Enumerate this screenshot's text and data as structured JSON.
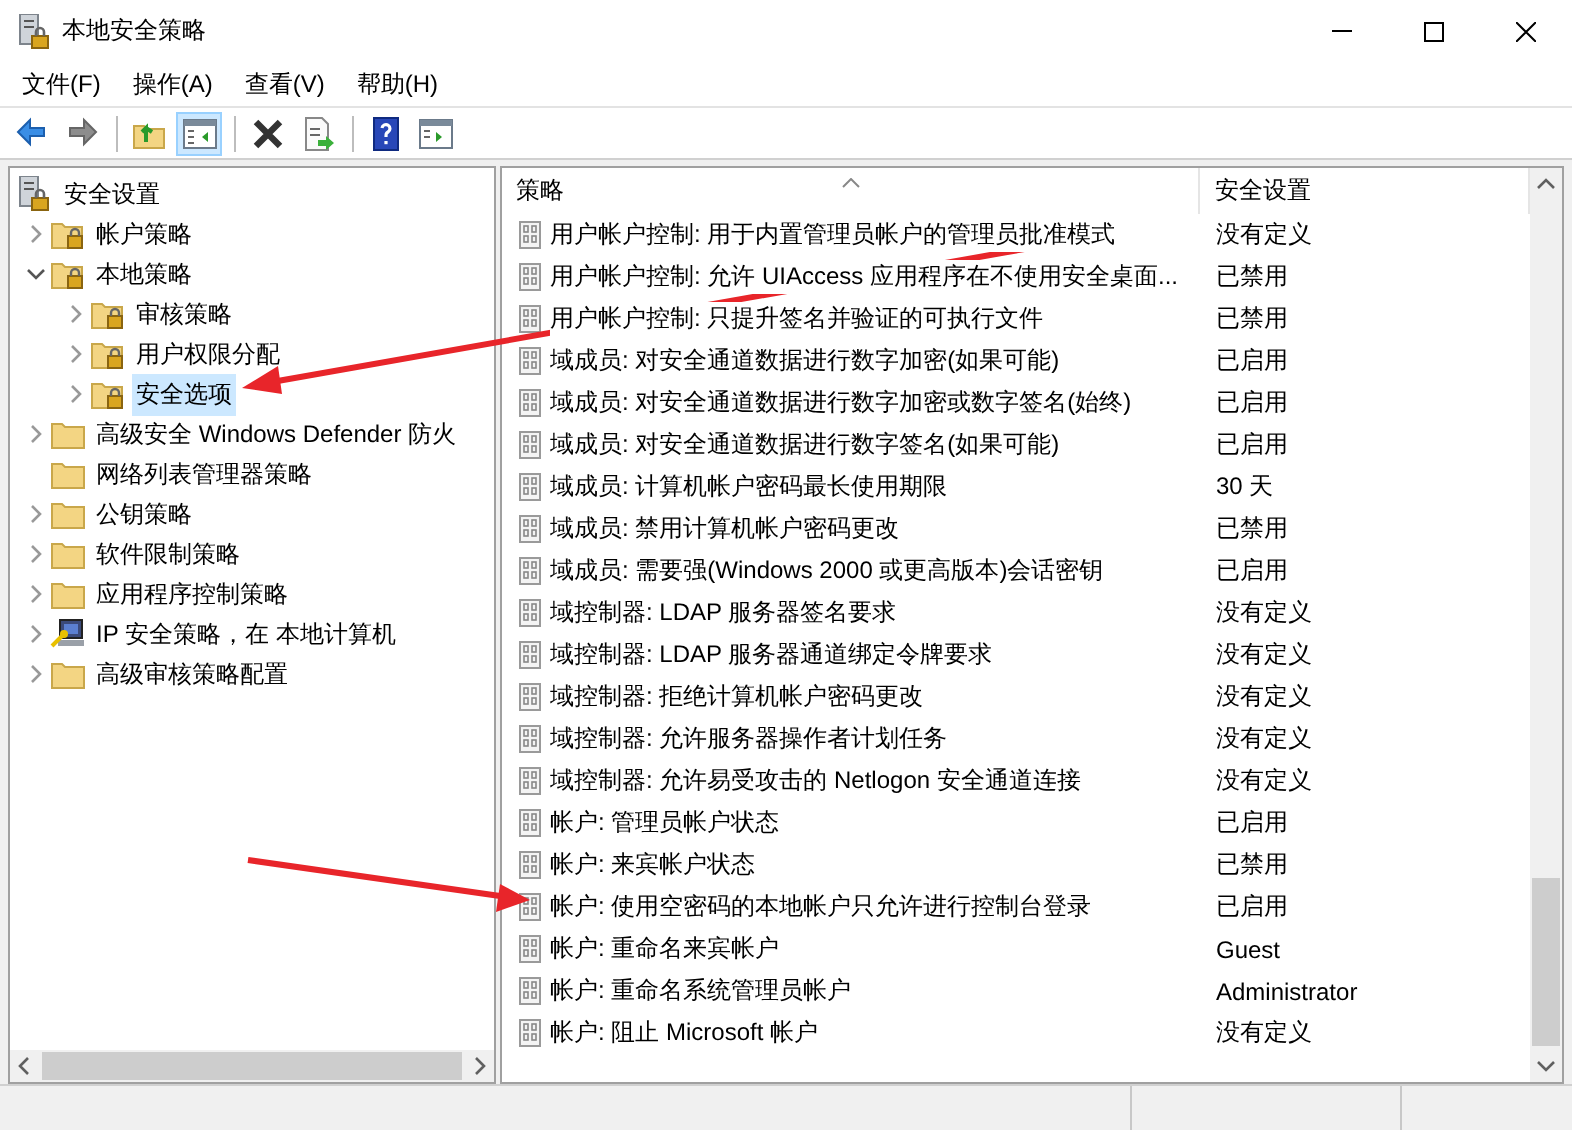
{
  "window": {
    "title": "本地安全策略"
  },
  "menu": [
    "文件(F)",
    "操作(A)",
    "查看(V)",
    "帮助(H)"
  ],
  "toolbar": [
    [
      {
        "kind": "back",
        "pressed": false
      },
      {
        "kind": "forward",
        "pressed": false
      }
    ],
    [
      {
        "kind": "up",
        "pressed": false
      },
      {
        "kind": "tree",
        "pressed": true
      }
    ],
    [
      {
        "kind": "delete",
        "pressed": false
      },
      {
        "kind": "export",
        "pressed": false
      }
    ],
    [
      {
        "kind": "help",
        "pressed": false
      },
      {
        "kind": "action-pane",
        "pressed": false
      }
    ]
  ],
  "tree": [
    {
      "label": "安全设置",
      "kind": "security",
      "selected": false,
      "children": [
        {
          "label": "帐户策略",
          "kind": "locked-folder",
          "expanded": false,
          "selected": false
        },
        {
          "label": "本地策略",
          "kind": "locked-folder",
          "expanded": true,
          "selected": false,
          "children": [
            {
              "label": "审核策略",
              "kind": "locked-folder",
              "expanded": false,
              "selected": false
            },
            {
              "label": "用户权限分配",
              "kind": "locked-folder",
              "expanded": false,
              "selected": false
            },
            {
              "label": "安全选项",
              "kind": "locked-folder",
              "expanded": false,
              "selected": true
            }
          ]
        },
        {
          "label": "高级安全 Windows Defender 防火",
          "kind": "folder",
          "expanded": false,
          "selected": false
        },
        {
          "label": "网络列表管理器策略",
          "kind": "folder",
          "selected": false
        },
        {
          "label": "公钥策略",
          "kind": "folder",
          "expanded": false,
          "selected": false
        },
        {
          "label": "软件限制策略",
          "kind": "folder",
          "expanded": false,
          "selected": false
        },
        {
          "label": "应用程序控制策略",
          "kind": "folder",
          "expanded": false,
          "selected": false
        },
        {
          "label": "IP 安全策略，在 本地计算机",
          "kind": "ip-policy",
          "expanded": false,
          "selected": false
        },
        {
          "label": "高级审核策略配置",
          "kind": "folder",
          "expanded": false,
          "selected": false
        }
      ]
    }
  ],
  "table": {
    "columns": [
      {
        "label": "策略",
        "sorted": true
      },
      {
        "label": "安全设置",
        "sorted": false
      }
    ],
    "rows": [
      {
        "policy": "用户帐户控制: 用于内置管理员帐户的管理员批准模式",
        "setting": "没有定义"
      },
      {
        "policy": "用户帐户控制: 允许 UIAccess 应用程序在不使用安全桌面...",
        "setting": "已禁用"
      },
      {
        "policy": "用户帐户控制: 只提升签名并验证的可执行文件",
        "setting": "已禁用"
      },
      {
        "policy": "域成员: 对安全通道数据进行数字加密(如果可能)",
        "setting": "已启用"
      },
      {
        "policy": "域成员: 对安全通道数据进行数字加密或数字签名(始终)",
        "setting": "已启用"
      },
      {
        "policy": "域成员: 对安全通道数据进行数字签名(如果可能)",
        "setting": "已启用"
      },
      {
        "policy": "域成员: 计算机帐户密码最长使用期限",
        "setting": "30 天"
      },
      {
        "policy": "域成员: 禁用计算机帐户密码更改",
        "setting": "已禁用"
      },
      {
        "policy": "域成员: 需要强(Windows 2000 或更高版本)会话密钥",
        "setting": "已启用"
      },
      {
        "policy": "域控制器: LDAP 服务器签名要求",
        "setting": "没有定义"
      },
      {
        "policy": "域控制器: LDAP 服务器通道绑定令牌要求",
        "setting": "没有定义"
      },
      {
        "policy": "域控制器: 拒绝计算机帐户密码更改",
        "setting": "没有定义"
      },
      {
        "policy": "域控制器: 允许服务器操作者计划任务",
        "setting": "没有定义"
      },
      {
        "policy": "域控制器:  允许易受攻击的 Netlogon 安全通道连接",
        "setting": "没有定义"
      },
      {
        "policy": "帐户: 管理员帐户状态",
        "setting": "已启用"
      },
      {
        "policy": "帐户: 来宾帐户状态",
        "setting": "已禁用"
      },
      {
        "policy": "帐户: 使用空密码的本地帐户只允许进行控制台登录",
        "setting": "已启用"
      },
      {
        "policy": "帐户: 重命名来宾帐户",
        "setting": "Guest"
      },
      {
        "policy": "帐户: 重命名系统管理员帐户",
        "setting": "Administrator"
      },
      {
        "policy": "帐户: 阻止 Microsoft 帐户",
        "setting": "没有定义"
      }
    ]
  }
}
